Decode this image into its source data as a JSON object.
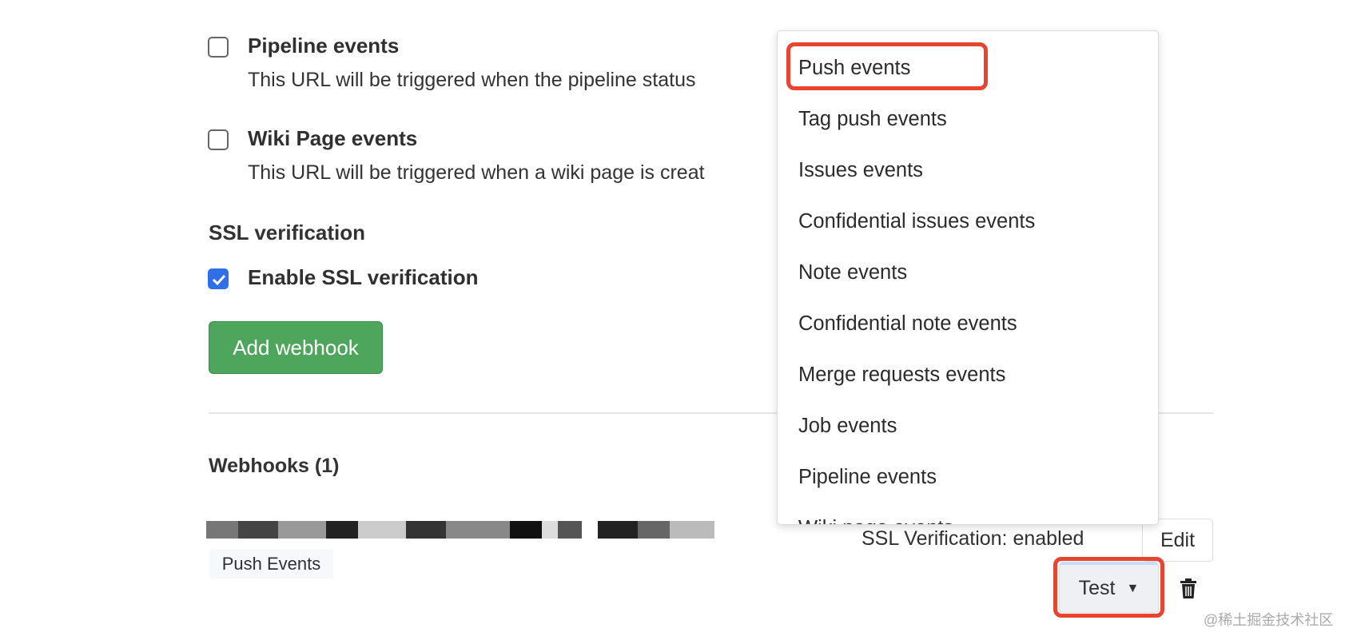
{
  "events": [
    {
      "title": "Pipeline events",
      "description": "This URL will be triggered when the pipeline status",
      "checked": false
    },
    {
      "title": "Wiki Page events",
      "description": "This URL will be triggered when a wiki page is creat",
      "checked": false
    }
  ],
  "ssl": {
    "heading": "SSL verification",
    "checkbox_label": "Enable SSL verification",
    "checked": true
  },
  "add_webhook_label": "Add webhook",
  "webhooks": {
    "heading": "Webhooks (1)",
    "items": [
      {
        "url_redacted": true,
        "badge": "Push Events",
        "ssl_status": "SSL Verification: enabled",
        "edit_label": "Edit",
        "test_label": "Test"
      }
    ]
  },
  "test_dropdown": {
    "items": [
      "Push events",
      "Tag push events",
      "Issues events",
      "Confidential issues events",
      "Note events",
      "Confidential note events",
      "Merge requests events",
      "Job events",
      "Pipeline events",
      "Wiki page events"
    ],
    "highlighted": "Push events"
  },
  "highlight_color": "#e84530",
  "accent_green": "#4ea65c",
  "watermark": "@稀土掘金技术社区"
}
